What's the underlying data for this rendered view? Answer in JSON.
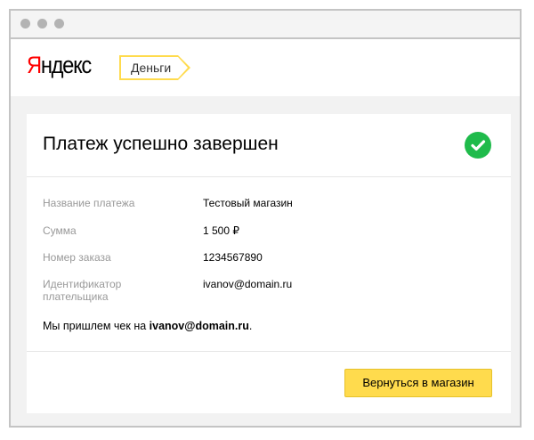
{
  "header": {
    "logo_first": "Я",
    "logo_rest": "ндекс",
    "tag": "Деньги"
  },
  "card": {
    "title": "Платеж успешно завершен",
    "rows": [
      {
        "label": "Название платежа",
        "value": "Тестовый магазин"
      },
      {
        "label": "Сумма",
        "value": "1 500 ₽"
      },
      {
        "label": "Номер заказа",
        "value": "1234567890"
      },
      {
        "label": "Идентификатор плательщика",
        "value": "ivanov@domain.ru"
      }
    ],
    "note_prefix": "Мы пришлем чек на ",
    "note_email": "ivanov@domain.ru",
    "note_suffix": ".",
    "button_label": "Вернуться в магазин"
  },
  "icons": {
    "success": "check-circle-icon"
  },
  "colors": {
    "accent": "#ffdb4d",
    "success": "#1fbb4b",
    "logo_red": "#ff0000"
  }
}
